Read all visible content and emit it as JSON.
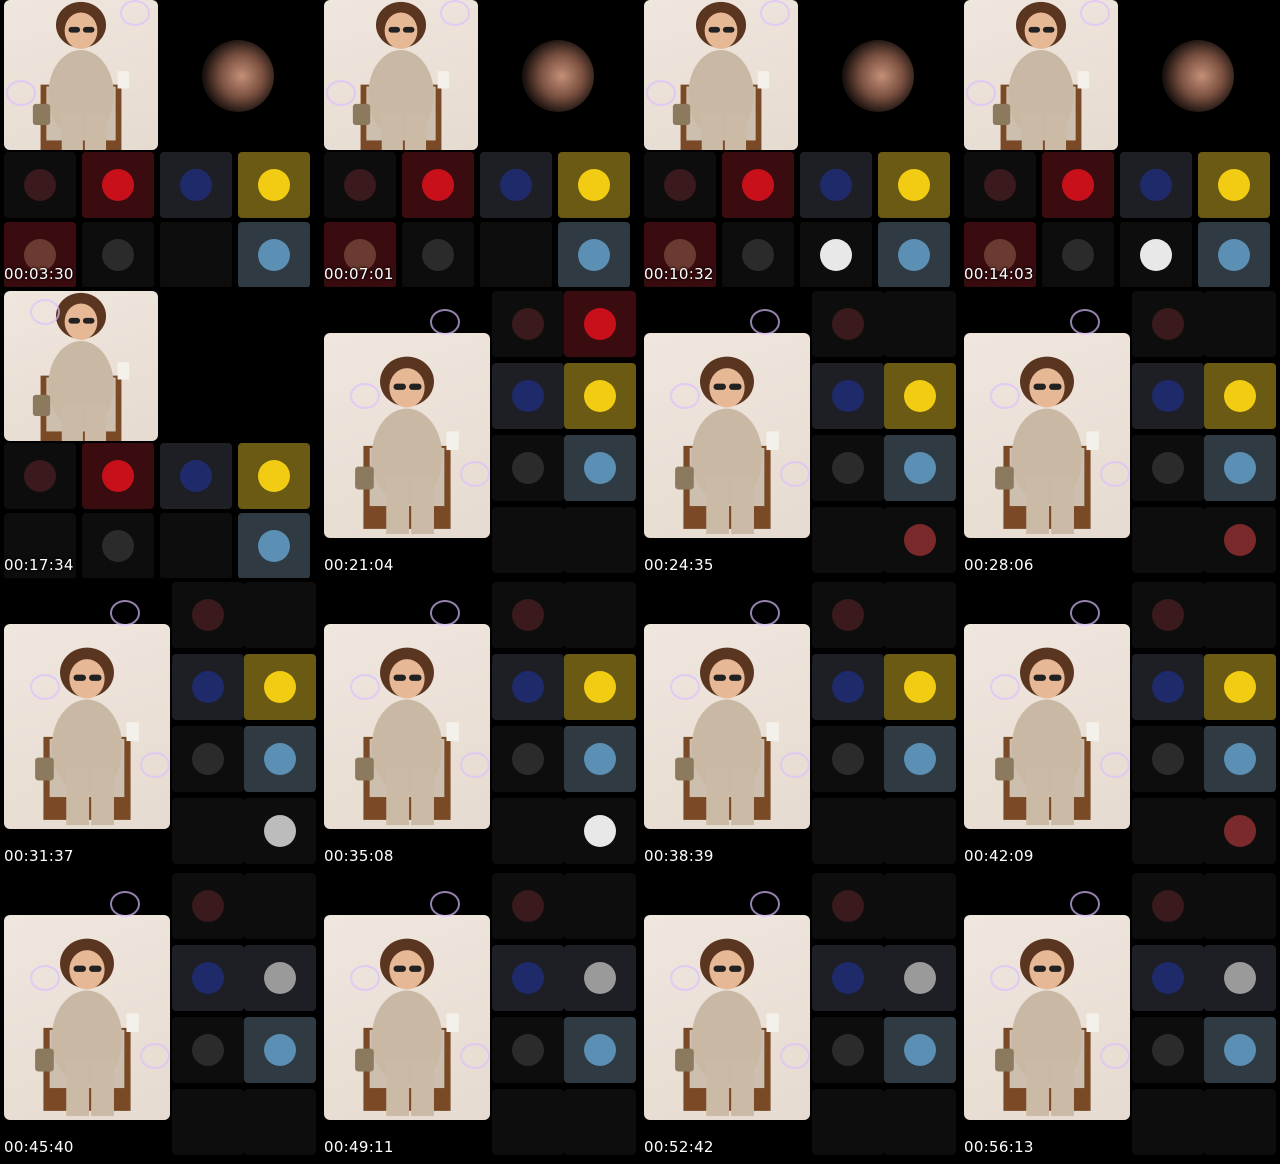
{
  "timestamps": [
    "00:03:30",
    "00:07:01",
    "00:10:32",
    "00:14:03",
    "00:17:34",
    "00:21:04",
    "00:24:35",
    "00:28:06",
    "00:31:37",
    "00:35:08",
    "00:38:39",
    "00:42:09",
    "00:45:40",
    "00:49:11",
    "00:52:42",
    "00:56:13"
  ],
  "colors": {
    "background": "#000000",
    "hero_bg": "#efe6de",
    "tile_red": "#c8101a",
    "tile_gold": "#f2cc12",
    "tile_slate": "#5b8fb3"
  },
  "icons": [
    "cartoon-woman-avatar",
    "red-circle-avatar",
    "blue-figure-avatar",
    "yellow-badge-avatar",
    "kaaba-avatar",
    "person-avatar",
    "heart-bubble-icon"
  ]
}
